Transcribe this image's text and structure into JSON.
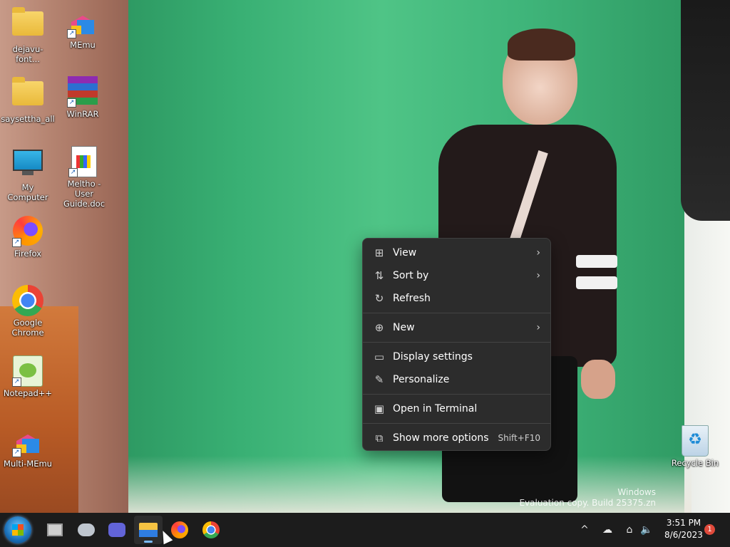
{
  "desktop": {
    "icons": [
      {
        "label": "dejavu-font...",
        "icon": "folder-icon"
      },
      {
        "label": "MEmu",
        "icon": "memu-icon"
      },
      {
        "label": "saysettha_all",
        "icon": "folder-icon"
      },
      {
        "label": "WinRAR",
        "icon": "winrar-icon"
      },
      {
        "label": "My Computer",
        "icon": "computer-icon"
      },
      {
        "label": "Meltho - User Guide.doc",
        "icon": "document-icon"
      },
      {
        "label": "Firefox",
        "icon": "firefox-icon"
      },
      {
        "label": "Google Chrome",
        "icon": "chrome-icon"
      },
      {
        "label": "Notepad++",
        "icon": "notepadpp-icon"
      },
      {
        "label": "Multi-MEmu",
        "icon": "memu-icon"
      },
      {
        "label": "Recycle Bin",
        "icon": "recycle-bin-icon"
      }
    ]
  },
  "context_menu": {
    "items": [
      {
        "label": "View",
        "icon": "grid-icon",
        "glyph": "⊞",
        "submenu": true
      },
      {
        "label": "Sort by",
        "icon": "sort-icon",
        "glyph": "⇅",
        "submenu": true
      },
      {
        "label": "Refresh",
        "icon": "refresh-icon",
        "glyph": "↻",
        "submenu": false
      },
      {
        "label": "New",
        "icon": "new-plus-icon",
        "glyph": "⊕",
        "submenu": true
      },
      {
        "label": "Display settings",
        "icon": "display-icon",
        "glyph": "▭",
        "submenu": false
      },
      {
        "label": "Personalize",
        "icon": "pen-icon",
        "glyph": "✎",
        "submenu": false
      },
      {
        "label": "Open in Terminal",
        "icon": "terminal-icon",
        "glyph": "▣",
        "submenu": false
      },
      {
        "label": "Show more options",
        "icon": "share-icon",
        "glyph": "⧉",
        "shortcut": "Shift+F10",
        "submenu": false
      }
    ],
    "submenu_glyph": "›"
  },
  "watermark": {
    "line1": "Windows",
    "line2": "Evaluation copy. Build 25375.zn"
  },
  "taskbar": {
    "apps": [
      {
        "name": "task-view-icon"
      },
      {
        "name": "cloud-icon"
      },
      {
        "name": "meet-icon"
      },
      {
        "name": "file-explorer-icon",
        "active": true
      },
      {
        "name": "firefox-icon"
      },
      {
        "name": "chrome-icon"
      }
    ],
    "tray": {
      "chevron": "^",
      "network_offline": "☁",
      "network": "⌂",
      "volume": "🔈"
    },
    "clock": {
      "time": "3:51 PM",
      "date": "8/6/2023"
    },
    "notification_count": "1"
  }
}
